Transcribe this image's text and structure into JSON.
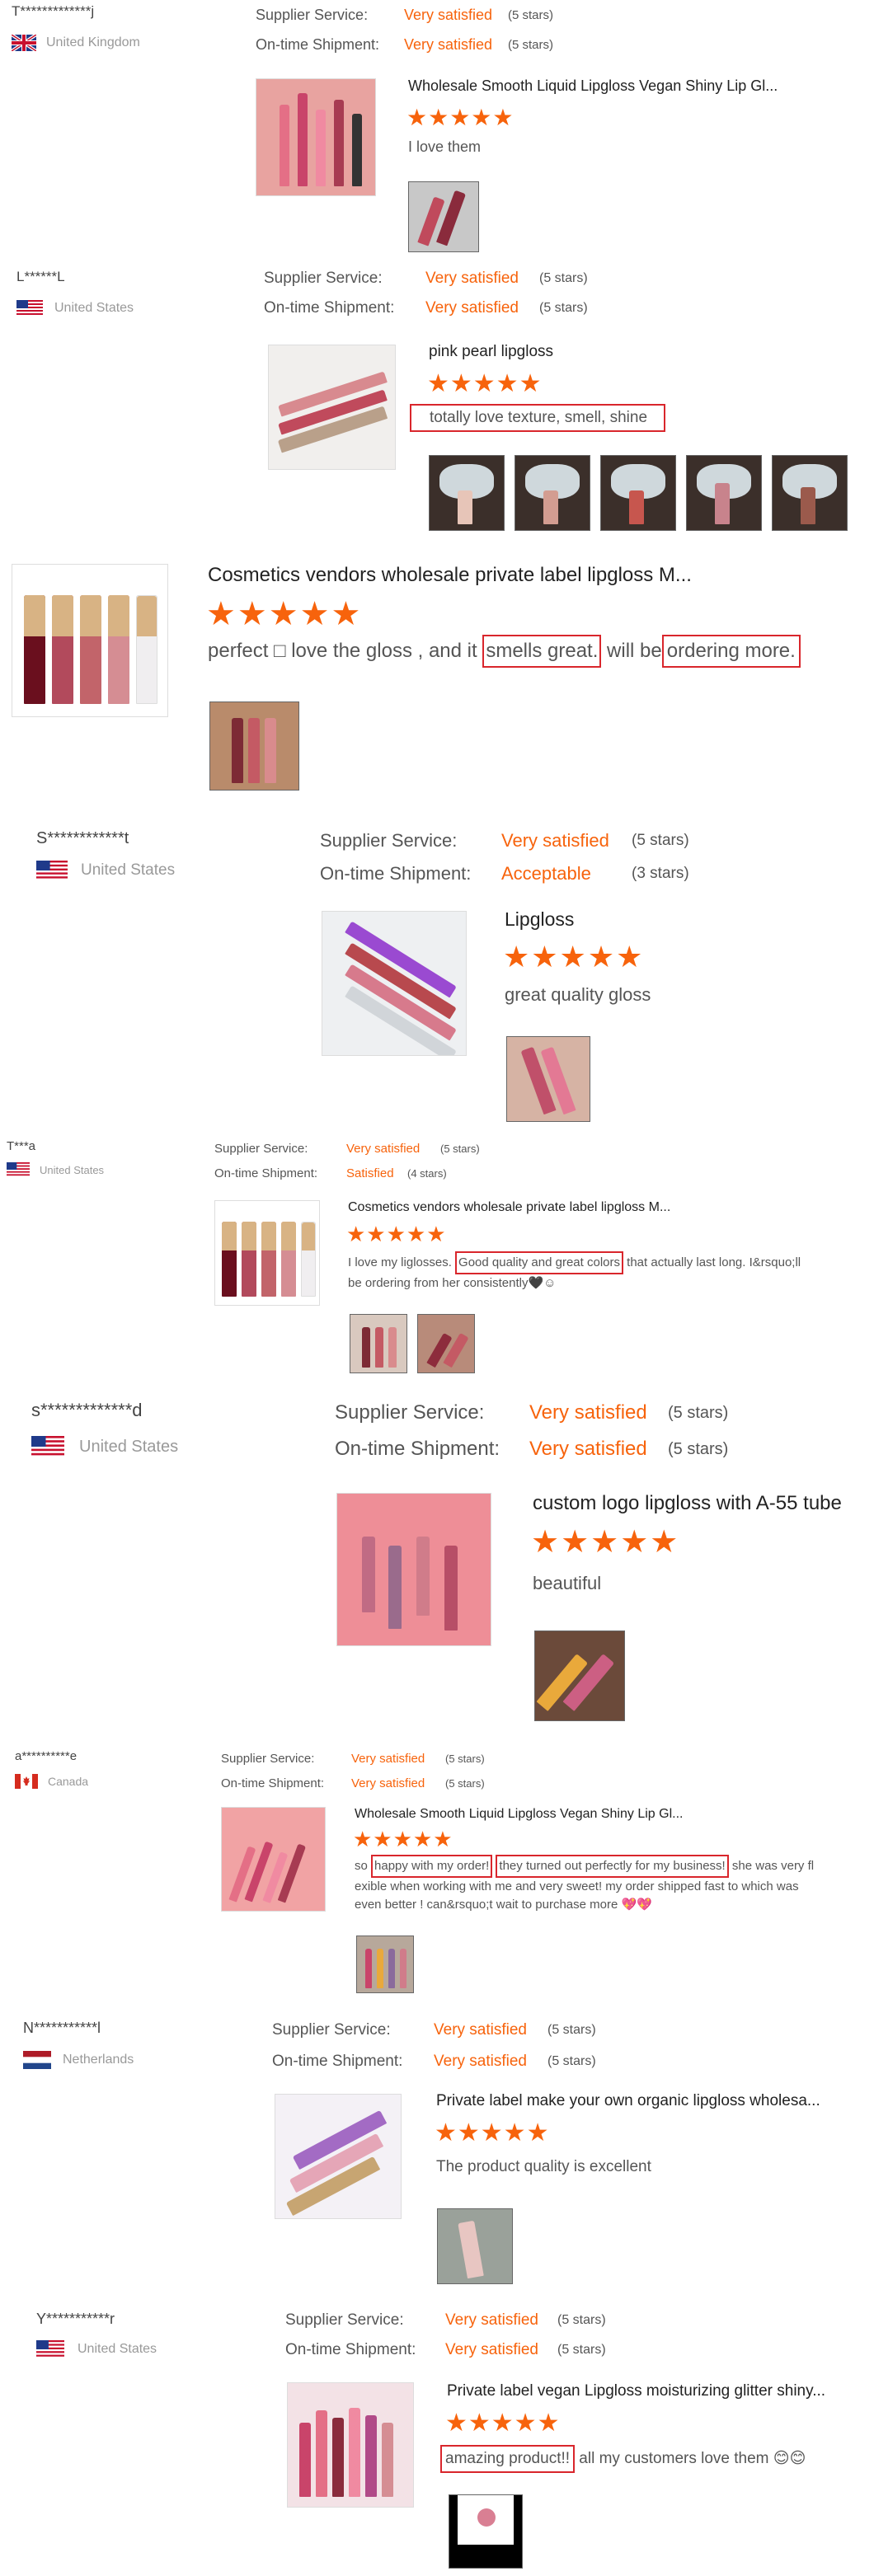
{
  "labels": {
    "supplier_service": "Supplier Service:",
    "on_time_shipment": "On-time Shipment:"
  },
  "colors": {
    "accent": "#f7630c",
    "highlight": "#d9262c",
    "text": "#333333",
    "muted": "#999999"
  },
  "reviews": [
    {
      "buyer": "T*************j",
      "country": "United Kingdom",
      "flag_icon": "uk-flag-icon",
      "supplier_service": "Very satisfied",
      "supplier_stars": "(5 stars)",
      "shipment": "Very satisfied",
      "shipment_stars": "(5 stars)",
      "product": "Wholesale Smooth Liquid Lipgloss Vegan Shiny Lip Gl...",
      "rating": "★★★★★",
      "rating_value": 5,
      "comment": [
        "I love them"
      ]
    },
    {
      "buyer": "L******L",
      "country": "United States",
      "flag_icon": "us-flag-icon",
      "supplier_service": "Very satisfied",
      "supplier_stars": "(5 stars)",
      "shipment": "Very satisfied",
      "shipment_stars": "(5 stars)",
      "product": "pink pearl lipgloss",
      "rating": "★★★★★",
      "rating_value": 5,
      "comment": [
        "totally love texture, smell, shine"
      ]
    },
    {
      "product": "Cosmetics vendors wholesale private label lipgloss M...",
      "rating": "★★★★★",
      "rating_value": 5,
      "comment": [
        "perfect □ love the gloss , and it ",
        "smells great.",
        " will be",
        "ordering more."
      ]
    },
    {
      "buyer": "S************t",
      "country": "United States",
      "flag_icon": "us-flag-icon",
      "supplier_service": "Very satisfied",
      "supplier_stars": "(5 stars)",
      "shipment": "Acceptable",
      "shipment_stars": "(3 stars)",
      "product": "Lipgloss",
      "rating": "★★★★★",
      "rating_value": 5,
      "comment": [
        "great quality gloss"
      ]
    },
    {
      "buyer": "T***a",
      "country": "United States",
      "flag_icon": "us-flag-icon",
      "supplier_service": "Very satisfied",
      "supplier_stars": "(5 stars)",
      "shipment": "Satisfied",
      "shipment_stars": "(4 stars)",
      "product": "Cosmetics vendors wholesale private label lipgloss M...",
      "rating": "★★★★★",
      "rating_value": 5,
      "comment": [
        "I love my liglosses. ",
        "Good quality and great colors",
        " that actually last long. I&rsquo;ll",
        "be ordering from her consistently🖤☺"
      ]
    },
    {
      "buyer": "s*************d",
      "country": "United States",
      "flag_icon": "us-flag-icon",
      "supplier_service": "Very satisfied",
      "supplier_stars": "(5 stars)",
      "shipment": "Very satisfied",
      "shipment_stars": "(5 stars)",
      "product": "custom logo lipgloss with A-55 tube",
      "rating": "★★★★★",
      "rating_value": 5,
      "comment": [
        "beautiful"
      ]
    },
    {
      "buyer": "a**********e",
      "country": "Canada",
      "flag_icon": "canada-flag-icon",
      "supplier_service": "Very satisfied",
      "supplier_stars": "(5 stars)",
      "shipment": "Very satisfied",
      "shipment_stars": "(5 stars)",
      "product": "Wholesale Smooth Liquid Lipgloss Vegan Shiny Lip Gl...",
      "rating": "★★★★★",
      "rating_value": 5,
      "comment": [
        "so ",
        "happy with my order!",
        " ",
        "they turned out perfectly for my business!",
        " she was very fl",
        "exible when working with me and very sweet! my order shipped fast to which was",
        "even better ! can&rsquo;t wait to purchase more 💖💖"
      ]
    },
    {
      "buyer": "N***********l",
      "country": "Netherlands",
      "flag_icon": "netherlands-flag-icon",
      "supplier_service": "Very satisfied",
      "supplier_stars": "(5 stars)",
      "shipment": "Very satisfied",
      "shipment_stars": "(5 stars)",
      "product": "Private label make your own organic lipgloss wholesa...",
      "rating": "★★★★★",
      "rating_value": 5,
      "comment": [
        "The product quality is excellent"
      ]
    },
    {
      "buyer": "Y***********r",
      "country": "United States",
      "flag_icon": "us-flag-icon",
      "supplier_service": "Very satisfied",
      "supplier_stars": "(5 stars)",
      "shipment": "Very satisfied",
      "shipment_stars": "(5 stars)",
      "product": "Private label vegan Lipgloss moisturizing glitter shiny...",
      "rating": "★★★★★",
      "rating_value": 5,
      "comment": [
        "amazing product!!",
        " all my customers love them 😊😊"
      ]
    }
  ]
}
